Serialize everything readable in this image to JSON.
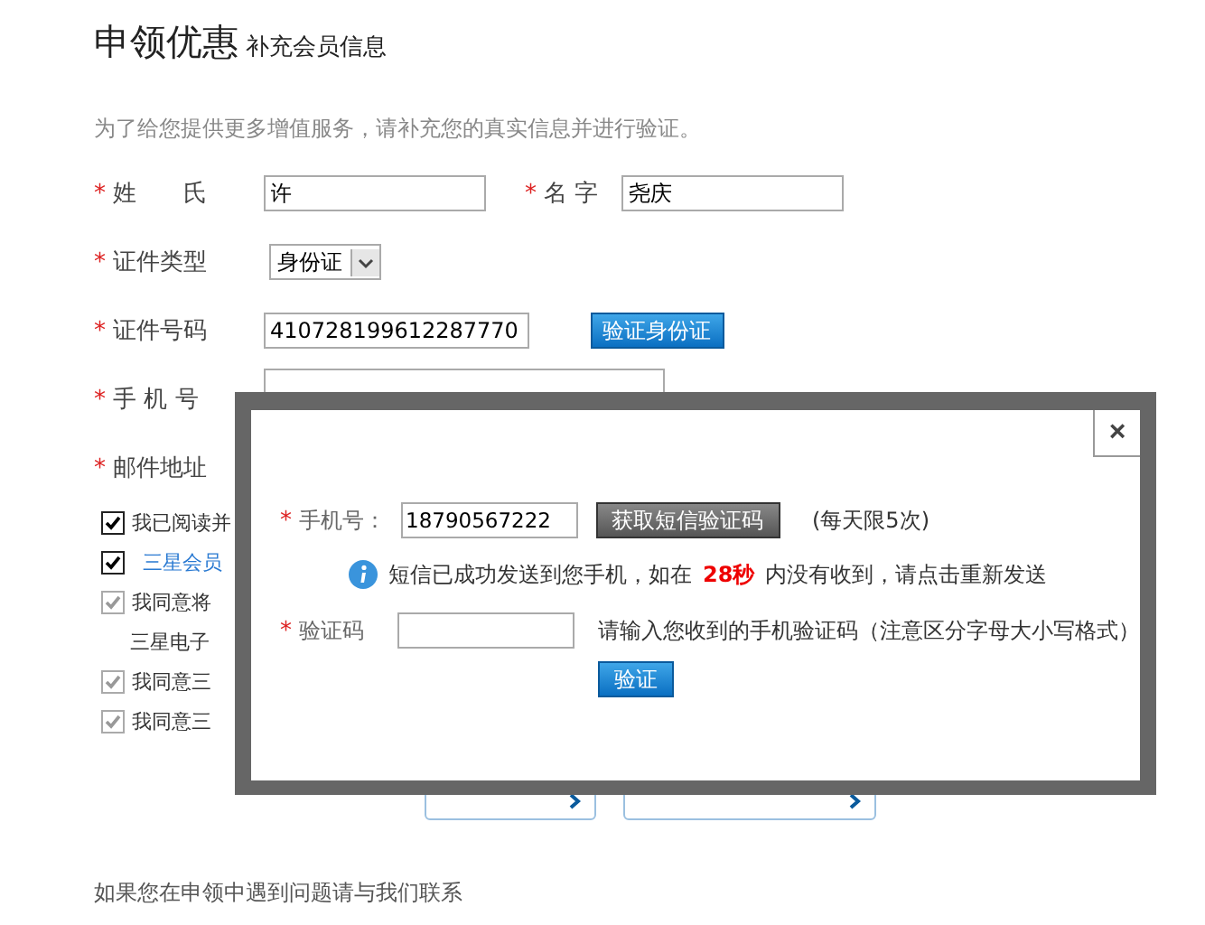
{
  "heading": {
    "title": "申领优惠",
    "subtitle": "补充会员信息"
  },
  "required_mark": "*",
  "intro": "为了给您提供更多增值服务，请补充您的真实信息并进行验证。",
  "form": {
    "surname": {
      "label": "姓　　氏",
      "value": "许"
    },
    "given_name": {
      "label": "名 字",
      "value": "尧庆"
    },
    "id_type": {
      "label": "证件类型",
      "value": "身份证"
    },
    "id_number": {
      "label": "证件号码",
      "value": "410728199612287770",
      "button": "验证身份证"
    },
    "mobile": {
      "label": "手 机 号"
    },
    "email": {
      "label": "邮件地址"
    }
  },
  "agreements": [
    {
      "text": "我已阅读并",
      "checked": true,
      "disabled": false,
      "kind": "plain"
    },
    {
      "text": "三星会员",
      "checked": true,
      "disabled": false,
      "kind": "link"
    },
    {
      "text": "我同意将",
      "checked": true,
      "disabled": true,
      "kind": "plain",
      "continuation": "三星电子"
    },
    {
      "text": "我同意三",
      "checked": true,
      "disabled": true,
      "kind": "plain"
    },
    {
      "text": "我同意三",
      "checked": true,
      "disabled": true,
      "kind": "plain"
    }
  ],
  "footer": {
    "contact": "如果您在申领中遇到问题请与我们联系"
  },
  "dialog": {
    "close": "×",
    "phone": {
      "label": "手机号：",
      "value": "18790567222",
      "button": "获取短信验证码",
      "limit": "(每天限5次)"
    },
    "notice": {
      "prefix": "短信已成功发送到您手机，如在",
      "countdown": "28秒",
      "suffix": "内没有收到，请点击重新发送"
    },
    "code": {
      "label": "验证码",
      "hint": "请输入您收到的手机验证码（注意区分字母大小写格式）"
    },
    "submit": "验证"
  }
}
